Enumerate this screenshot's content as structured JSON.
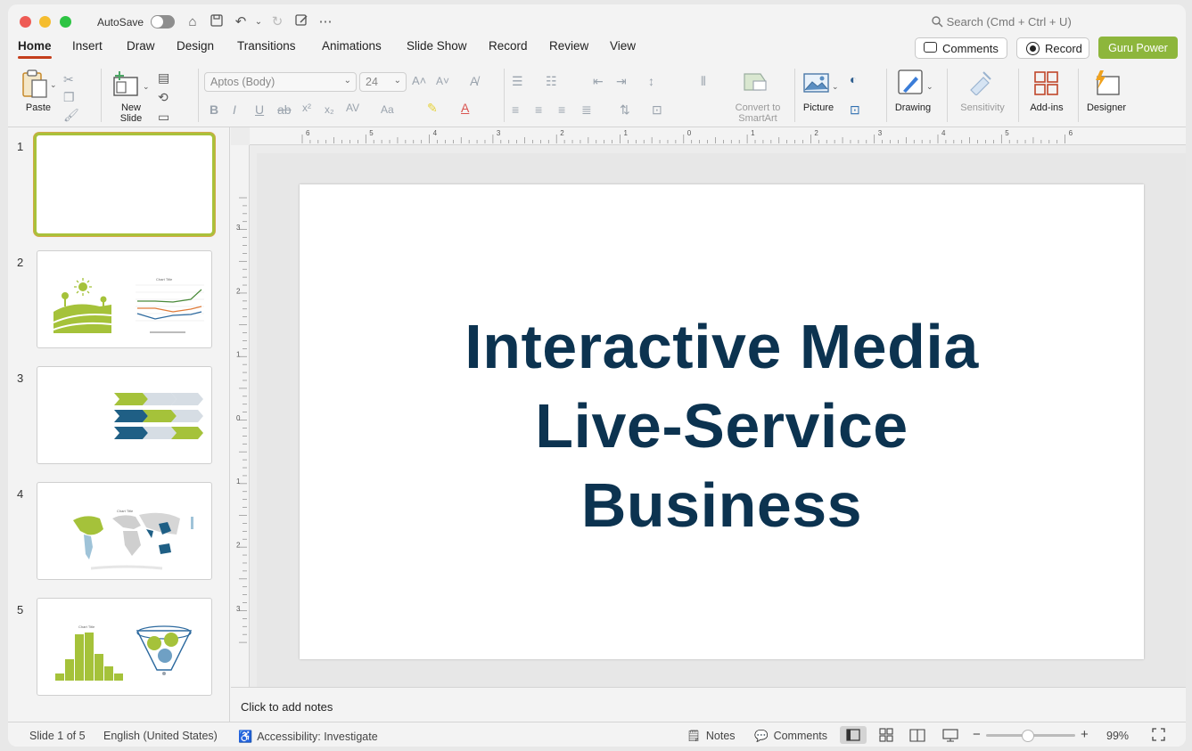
{
  "titlebar": {
    "autosave_label": "AutoSave",
    "search_placeholder": "Search (Cmd + Ctrl + U)"
  },
  "tabs": [
    "Home",
    "Insert",
    "Draw",
    "Design",
    "Transitions",
    "Animations",
    "Slide Show",
    "Record",
    "Review",
    "View"
  ],
  "header_buttons": {
    "comments": "Comments",
    "record": "Record",
    "guru": "Guru Power"
  },
  "colors": {
    "accent_tab": "#c43e1c",
    "guru_button": "#8db63c",
    "title_text": "#0c3350",
    "thumb_selected": "#a9c13a"
  },
  "ribbon": {
    "paste": "Paste",
    "new_slide": "New Slide",
    "font_name": "Aptos (Body)",
    "font_size": "24",
    "convert_smartart": "Convert to SmartArt",
    "picture": "Picture",
    "drawing": "Drawing",
    "sensitivity": "Sensitivity",
    "addins": "Add-ins",
    "designer": "Designer"
  },
  "ruler": {
    "h_numbers": [
      "6",
      "5",
      "4",
      "3",
      "2",
      "1",
      "0",
      "1",
      "2",
      "3",
      "4",
      "5",
      "6"
    ],
    "v_numbers": [
      "3",
      "2",
      "1",
      "0",
      "1",
      "2",
      "3"
    ]
  },
  "slides": [
    {
      "number": "1",
      "selected": true
    },
    {
      "number": "2",
      "chart_title": "Chart Title"
    },
    {
      "number": "3"
    },
    {
      "number": "4",
      "chart_title": "Chart Title"
    },
    {
      "number": "5",
      "chart_title": "Chart Title"
    }
  ],
  "slide_content": {
    "title_line1": "Interactive Media",
    "title_line2": "Live-Service",
    "title_line3": "Business"
  },
  "notes_placeholder": "Click to add notes",
  "status": {
    "slide_position": "Slide 1 of 5",
    "language": "English (United States)",
    "accessibility": "Accessibility: Investigate",
    "notes": "Notes",
    "comments": "Comments",
    "zoom": "99%"
  }
}
